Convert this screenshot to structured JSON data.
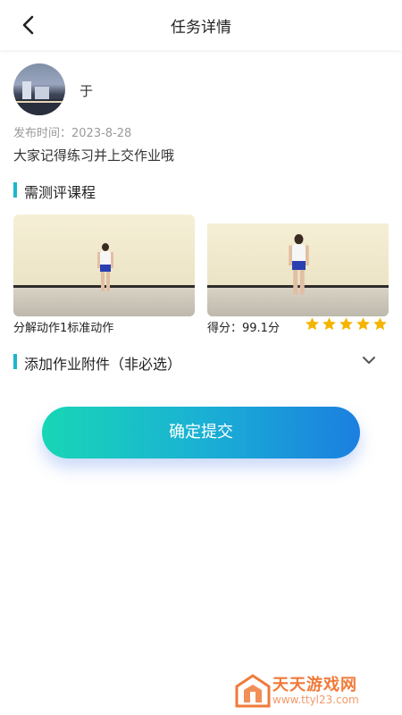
{
  "header": {
    "title": "任务详情"
  },
  "task": {
    "user_name": "于",
    "publish_time": "发布时间：2023-8-28",
    "description": "大家记得练习并上交作业哦"
  },
  "sections": {
    "courses_title": "需测评课程",
    "attachment_title": "添加作业附件（非必选）"
  },
  "videos": [
    {
      "caption": "分解动作1标准动作"
    },
    {
      "caption": "得分：99.1分",
      "rating": 5,
      "max_rating": 5
    }
  ],
  "submit": {
    "label": "确定提交"
  },
  "watermark": {
    "name": "天天游戏网",
    "url": "www.ttyl23.com"
  },
  "colors": {
    "accent": "#1eb5ce",
    "star": "#f5b400",
    "button_start": "#18d6b5",
    "button_end": "#1b7fe0"
  }
}
